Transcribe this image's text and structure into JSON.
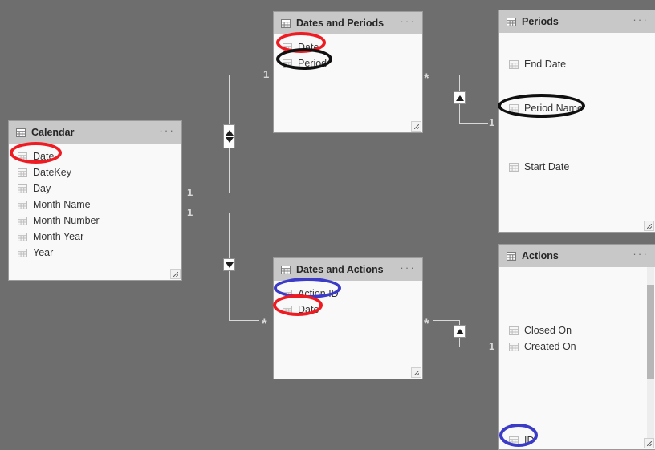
{
  "app": {
    "view": "model-view",
    "canvas_color": "#6e6e6e"
  },
  "annotation_colors": {
    "red": "#ee1c22",
    "black": "#101010",
    "blue": "#3b3bc8"
  },
  "icons": {
    "table_header": "table-grid-icon",
    "column": "column-grid-icon",
    "menu": "ellipsis-more-icon",
    "resize": "resize-grip-icon"
  },
  "tables": [
    {
      "id": "calendar",
      "name": "Calendar",
      "menu": "···",
      "columns": [
        {
          "name": "Date",
          "highlight": "red"
        },
        {
          "name": "DateKey",
          "highlight": null
        },
        {
          "name": "Day",
          "highlight": null
        },
        {
          "name": "Month Name",
          "highlight": null
        },
        {
          "name": "Month Number",
          "highlight": null
        },
        {
          "name": "Month Year",
          "highlight": null
        },
        {
          "name": "Year",
          "highlight": null
        }
      ]
    },
    {
      "id": "dates-and-periods",
      "name": "Dates and Periods",
      "menu": "···",
      "columns": [
        {
          "name": "Date",
          "highlight": "red"
        },
        {
          "name": "Period",
          "highlight": "black"
        }
      ]
    },
    {
      "id": "periods",
      "name": "Periods",
      "menu": "···",
      "columns": [
        {
          "name": "End Date",
          "highlight": null
        },
        {
          "name": "Period Name",
          "highlight": "black"
        },
        {
          "name": "Start Date",
          "highlight": null
        }
      ]
    },
    {
      "id": "dates-and-actions",
      "name": "Dates and Actions",
      "menu": "···",
      "columns": [
        {
          "name": "Action ID",
          "highlight": "blue"
        },
        {
          "name": "Date",
          "highlight": "red"
        }
      ]
    },
    {
      "id": "actions",
      "name": "Actions",
      "menu": "···",
      "columns": [
        {
          "name": "Closed On",
          "highlight": null
        },
        {
          "name": "Created On",
          "highlight": null
        },
        {
          "name": "ID",
          "highlight": "blue"
        }
      ]
    }
  ],
  "relationships": [
    {
      "id": "calendar-to-dates-and-periods",
      "from_table": "Calendar",
      "to_table": "Dates and Periods",
      "from_cardinality": "1",
      "to_cardinality": "1",
      "cross_filter": "both",
      "marker": "bidirectional-arrow"
    },
    {
      "id": "calendar-to-dates-and-actions",
      "from_table": "Calendar",
      "to_table": "Dates and Actions",
      "from_cardinality": "1",
      "to_cardinality": "*",
      "cross_filter": "single",
      "marker": "down-arrow"
    },
    {
      "id": "dates-and-periods-to-periods",
      "from_table": "Dates and Periods",
      "to_table": "Periods",
      "from_cardinality": "*",
      "to_cardinality": "1",
      "cross_filter": "single",
      "marker": "up-arrow"
    },
    {
      "id": "dates-and-actions-to-actions",
      "from_table": "Dates and Actions",
      "to_table": "Actions",
      "from_cardinality": "*",
      "to_cardinality": "1",
      "cross_filter": "single",
      "marker": "up-arrow"
    }
  ]
}
